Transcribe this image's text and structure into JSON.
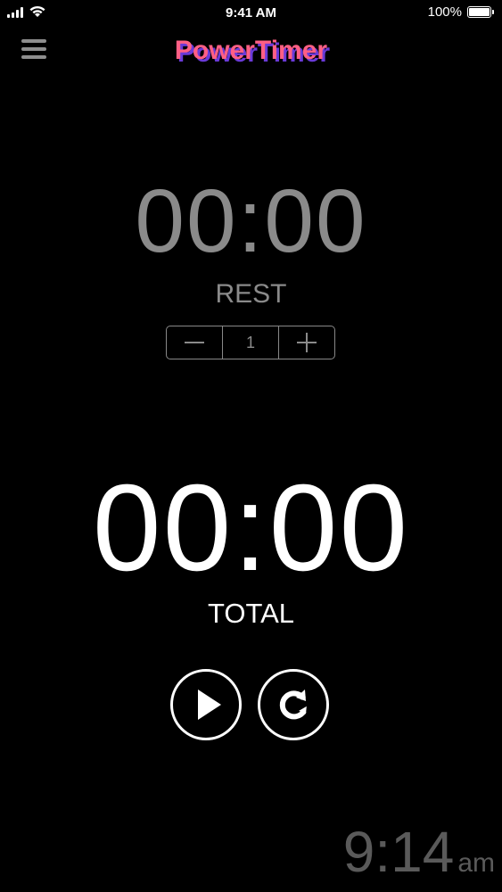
{
  "status_bar": {
    "time": "9:41 AM",
    "battery": "100%",
    "icons": [
      "signal-icon",
      "wifi-icon",
      "battery-icon"
    ]
  },
  "header": {
    "app_title": "PowerTimer",
    "menu_icon": "hamburger-menu-icon"
  },
  "rest": {
    "time": "00:00",
    "label": "REST",
    "stepper": {
      "decrement_symbol": "−",
      "value": "1",
      "increment_symbol": "+"
    }
  },
  "total": {
    "time": "00:00",
    "label": "TOTAL"
  },
  "controls": {
    "play_icon": "play-icon",
    "reset_icon": "reset-icon"
  },
  "clock": {
    "time": "9:14",
    "ampm": "am"
  },
  "colors": {
    "background": "#000000",
    "title_pink": "#ff5f85",
    "title_shadow_purple": "#6a3ad8",
    "rest_gray": "#8a8a8a",
    "clock_gray": "#5a5a5a"
  }
}
